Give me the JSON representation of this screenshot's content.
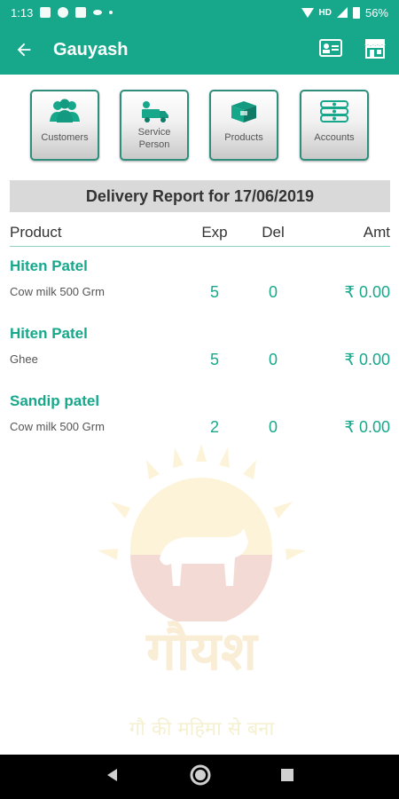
{
  "status_bar": {
    "time": "1:13",
    "network": "HD",
    "battery": "56%"
  },
  "app_bar": {
    "title": "Gauyash",
    "back_icon": "arrow-back-icon",
    "actions": [
      "id-card-icon",
      "store-icon"
    ]
  },
  "tiles": [
    {
      "label": "Customers",
      "icon": "people-icon"
    },
    {
      "label": "Service Person",
      "icon": "delivery-truck-icon"
    },
    {
      "label": "Products",
      "icon": "box-icon"
    },
    {
      "label": "Accounts",
      "icon": "money-stack-icon"
    }
  ],
  "report": {
    "title": "Delivery Report for 17/06/2019",
    "columns": {
      "product": "Product",
      "exp": "Exp",
      "del": "Del",
      "amt": "Amt"
    },
    "rows": [
      {
        "customer": "Hiten Patel",
        "product": "Cow milk 500 Grm",
        "exp": "5",
        "del": "0",
        "amt": "₹ 0.00"
      },
      {
        "customer": "Hiten Patel",
        "product": "Ghee",
        "exp": "5",
        "del": "0",
        "amt": "₹ 0.00"
      },
      {
        "customer": "Sandip patel",
        "product": "Cow milk 500 Grm",
        "exp": "2",
        "del": "0",
        "amt": "₹ 0.00"
      }
    ]
  },
  "watermark": {
    "logo_text": "गौयश",
    "tagline": "गौ की महिमा से बना"
  },
  "nav_bar": {
    "buttons": [
      "back-triangle-icon",
      "home-circle-icon",
      "recents-square-icon"
    ]
  },
  "colors": {
    "primary": "#17a88c",
    "tile_border": "#2e8d7b",
    "banner_bg": "#d9d9d9",
    "text_dark": "#333333"
  }
}
